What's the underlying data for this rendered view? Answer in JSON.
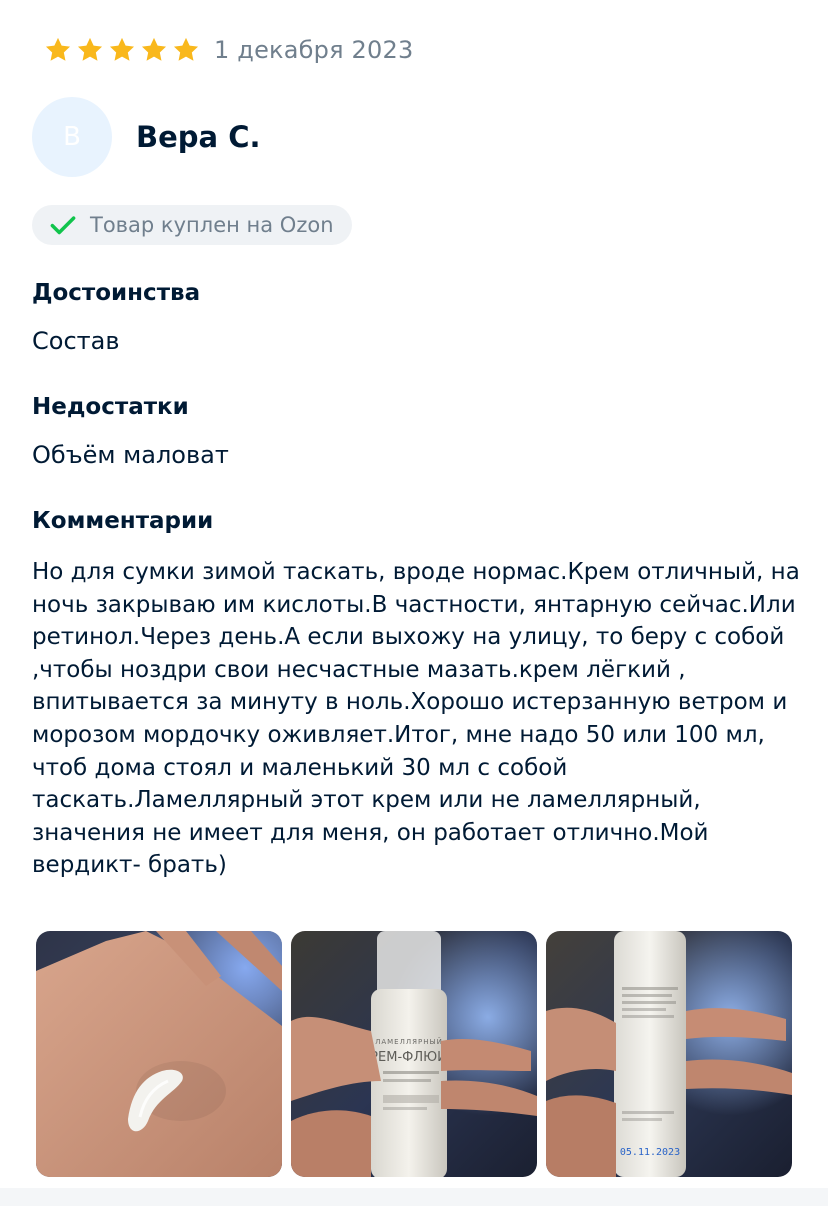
{
  "review": {
    "rating": 5,
    "date": "1 декабря 2023",
    "author": {
      "initial": "В",
      "name": "Вера С."
    },
    "badge": "Товар куплен на Ozon",
    "sections": {
      "pros_title": "Достоинства",
      "pros_text": "Состав",
      "cons_title": "Недостатки",
      "cons_text": "Объём маловат",
      "comment_title": "Комментарии",
      "comment_text": "Но для сумки зимой таскать, вроде нормас.Крем отличный, на ночь закрываю им кислоты.В частности, янтарную сейчас.Или ретинол.Через день.А если выхожу на улицу, то беру с собой ,чтобы ноздри свои несчастные мазать.крем лёгкий , впитывается за минуту в ноль.Хорошо истерзанную ветром и морозом мордочку оживляет.Итог, мне надо 50 или 100 мл, чтоб дома стоял и маленький 30 мл с собой таскать.Ламеллярный этот крем или не ламеллярный, значения не имеет для меня, он работает отлично.Мой вердикт- брать)"
    },
    "photos": [
      {
        "label": ""
      },
      {
        "label": "КРЕМ-ФЛЮИД"
      },
      {
        "label": "05.11.2023"
      }
    ]
  },
  "colors": {
    "star": "#f9b81c",
    "check": "#10c44c",
    "text_primary": "#001a34",
    "text_secondary": "#707f8d",
    "badge_bg": "#eff2f5",
    "avatar_bg": "#e8f3fe"
  },
  "icons": {
    "star": "star-icon",
    "check": "check-icon"
  }
}
